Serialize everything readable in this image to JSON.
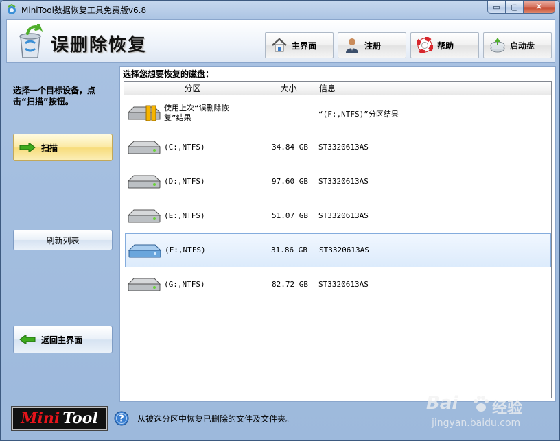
{
  "window": {
    "title": "MiniTool数据恢复工具免费版v6.8",
    "controls": {
      "minimize": "▭",
      "maximize": "▢",
      "close": "✕"
    }
  },
  "header": {
    "title": "误删除恢复",
    "buttons": [
      {
        "label": "主界面",
        "icon": "home-icon"
      },
      {
        "label": "注册",
        "icon": "user-icon"
      },
      {
        "label": "帮助",
        "icon": "lifebuoy-icon"
      },
      {
        "label": "启动盘",
        "icon": "boot-disk-icon"
      }
    ]
  },
  "left_panel": {
    "instruction": "选择一个目标设备，点击“扫描”按钮。",
    "scan_label": "扫描",
    "refresh_label": "刷新列表",
    "back_label": "返回主界面"
  },
  "list": {
    "caption": "选择您想要恢复的磁盘：",
    "columns": {
      "partition": "分区",
      "size": "大小",
      "info": "信息"
    },
    "rows": [
      {
        "name_line1": "使用上次“误删除恢",
        "name_line2": "复”结果",
        "size": "",
        "info": "“(F:,NTFS)”分区结果",
        "selected": false,
        "icon": "previous-result-disk-icon"
      },
      {
        "name_line1": "(C:,NTFS)",
        "name_line2": "",
        "size": "34.84 GB",
        "info": "ST3320613AS",
        "selected": false,
        "icon": "hard-disk-icon"
      },
      {
        "name_line1": "(D:,NTFS)",
        "name_line2": "",
        "size": "97.60 GB",
        "info": "ST3320613AS",
        "selected": false,
        "icon": "hard-disk-icon"
      },
      {
        "name_line1": "(E:,NTFS)",
        "name_line2": "",
        "size": "51.07 GB",
        "info": "ST3320613AS",
        "selected": false,
        "icon": "hard-disk-icon"
      },
      {
        "name_line1": "(F:,NTFS)",
        "name_line2": "",
        "size": "31.86 GB",
        "info": "ST3320613AS",
        "selected": true,
        "icon": "hard-disk-icon"
      },
      {
        "name_line1": "(G:,NTFS)",
        "name_line2": "",
        "size": "82.72 GB",
        "info": "ST3320613AS",
        "selected": false,
        "icon": "hard-disk-icon"
      }
    ]
  },
  "footer": {
    "logo_mini": "Mini",
    "logo_tool": "Tool",
    "help_text": "从被选分区中恢复已删除的文件及文件夹。"
  },
  "watermark": {
    "brand": "Bai",
    "brand_cn": "经验",
    "url": "jingyan.baidu.com"
  },
  "colors": {
    "selected_row": "#dcebfc",
    "scan_button": "#f7dc7a",
    "logo_red": "#e8141b"
  }
}
